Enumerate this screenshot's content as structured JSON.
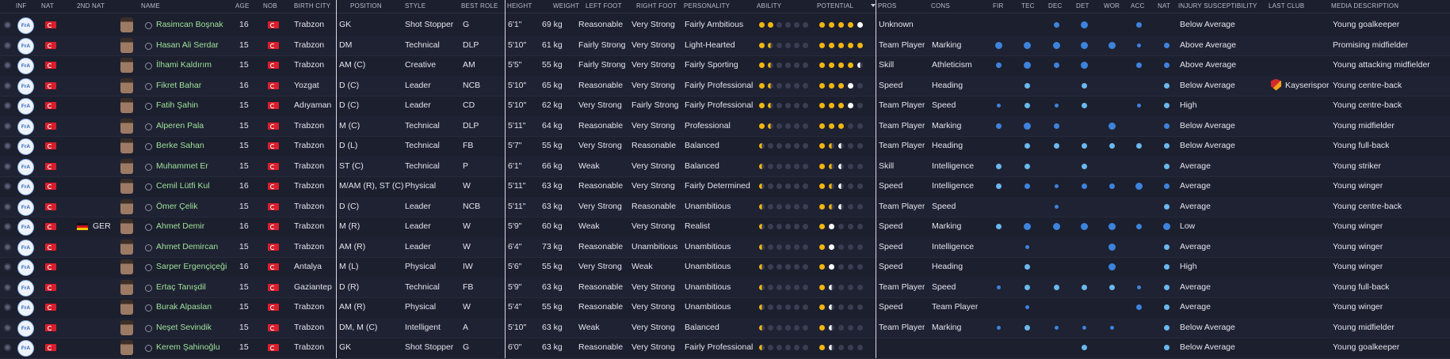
{
  "columns": [
    "INF",
    "NAT",
    "2ND NAT",
    "NAME",
    "AGE",
    "NOB",
    "BIRTH CITY",
    "POSITION",
    "STYLE",
    "BEST ROLE",
    "HEIGHT",
    "WEIGHT",
    "LEFT FOOT",
    "RIGHT FOOT",
    "PERSONALITY",
    "ABILITY",
    "POTENTIAL",
    "PROS",
    "CONS",
    "FIR",
    "TEC",
    "DEC",
    "DET",
    "WOR",
    "ACC",
    "NAT",
    "INJURY SUSCEPTIBILITY",
    "LAST CLUB",
    "MEDIA DESCRIPTION"
  ],
  "club_badge_text": "FrA",
  "colors": {
    "name_green": "#9fe39c",
    "star_gold": "#f2b60f",
    "attr_blue": "#3d83dd",
    "attr_light": "#6ab8ef"
  },
  "players": [
    {
      "name": "Rasimcan Boşnak",
      "second_nat": "",
      "age": "16",
      "city": "Trabzon",
      "position": "GK",
      "style": "Shot Stopper",
      "best_role": "G",
      "height": "6'1\"",
      "weight": "69 kg",
      "left_foot": "Reasonable",
      "right_foot": "Very Strong",
      "personality": "Fairly Ambitious",
      "ability": [
        1,
        1,
        0,
        0,
        0,
        0
      ],
      "potential": [
        1,
        1,
        1,
        1,
        2
      ],
      "pros": "Unknown",
      "cons": "",
      "attrs": [
        "",
        "",
        "m",
        "l",
        "",
        "m",
        ""
      ],
      "injury": "Below Average",
      "last_club": "",
      "media": "Young goalkeeper"
    },
    {
      "name": "Hasan Ali Serdar",
      "second_nat": "",
      "age": "15",
      "city": "Trabzon",
      "position": "DM",
      "style": "Technical",
      "best_role": "DLP",
      "height": "5'10\"",
      "weight": "61 kg",
      "left_foot": "Fairly Strong",
      "right_foot": "Very Strong",
      "personality": "Light-Hearted",
      "ability": [
        1,
        0.5,
        0,
        0,
        0,
        0
      ],
      "potential": [
        1,
        1,
        1,
        1,
        1
      ],
      "pros": "Team Player",
      "cons": "Marking",
      "attrs": [
        "l",
        "l",
        "l",
        "l",
        "l",
        "s",
        "m"
      ],
      "injury": "Above Average",
      "last_club": "",
      "media": "Promising midfielder"
    },
    {
      "name": "İlhami Kaldırım",
      "second_nat": "",
      "age": "15",
      "city": "Trabzon",
      "position": "AM (C)",
      "style": "Creative",
      "best_role": "AM",
      "height": "5'5\"",
      "weight": "55 kg",
      "left_foot": "Fairly Strong",
      "right_foot": "Very Strong",
      "personality": "Fairly Sporting",
      "ability": [
        1,
        0.5,
        0,
        0,
        0,
        0
      ],
      "potential": [
        1,
        1,
        1,
        1,
        2.5
      ],
      "pros": "Skill",
      "cons": "Athleticism",
      "attrs": [
        "m",
        "l",
        "m",
        "l",
        "",
        "m",
        "m"
      ],
      "injury": "Above Average",
      "last_club": "",
      "media": "Young attacking midfielder"
    },
    {
      "name": "Fikret Bahar",
      "second_nat": "",
      "age": "16",
      "city": "Yozgat",
      "position": "D (C)",
      "style": "Leader",
      "best_role": "NCB",
      "height": "5'10\"",
      "weight": "65 kg",
      "left_foot": "Reasonable",
      "right_foot": "Very Strong",
      "personality": "Fairly Professional",
      "ability": [
        1,
        0.5,
        0,
        0,
        0,
        0
      ],
      "potential": [
        1,
        1,
        1,
        2,
        0
      ],
      "pros": "Speed",
      "cons": "Heading",
      "attrs": [
        "",
        "lt",
        "",
        "lt",
        "",
        "",
        "lt"
      ],
      "injury": "Below Average",
      "last_club": "Kayserispor",
      "media": "Young centre-back"
    },
    {
      "name": "Fatih Şahin",
      "second_nat": "",
      "age": "15",
      "city": "Adıyaman",
      "position": "D (C)",
      "style": "Leader",
      "best_role": "CD",
      "height": "5'10\"",
      "weight": "62 kg",
      "left_foot": "Very Strong",
      "right_foot": "Fairly Strong",
      "personality": "Fairly Professional",
      "ability": [
        1,
        0.5,
        0,
        0,
        0,
        0
      ],
      "potential": [
        1,
        1,
        1,
        2,
        0
      ],
      "pros": "Team Player",
      "cons": "Speed",
      "attrs": [
        "s",
        "lt",
        "s",
        "lt",
        "",
        "s",
        "lt"
      ],
      "injury": "High",
      "last_club": "",
      "media": "Young centre-back"
    },
    {
      "name": "Alperen Pala",
      "second_nat": "",
      "age": "15",
      "city": "Trabzon",
      "position": "M (C)",
      "style": "Technical",
      "best_role": "DLP",
      "height": "5'11\"",
      "weight": "64 kg",
      "left_foot": "Reasonable",
      "right_foot": "Very Strong",
      "personality": "Professional",
      "ability": [
        1,
        0.5,
        0,
        0,
        0,
        0
      ],
      "potential": [
        1,
        1,
        1,
        0,
        0
      ],
      "pros": "Team Player",
      "cons": "Marking",
      "attrs": [
        "m",
        "l",
        "m",
        "",
        "l",
        "",
        "m"
      ],
      "injury": "Below Average",
      "last_club": "",
      "media": "Young midfielder"
    },
    {
      "name": "Berke Sahan",
      "second_nat": "",
      "age": "15",
      "city": "Trabzon",
      "position": "D (L)",
      "style": "Technical",
      "best_role": "FB",
      "height": "5'7\"",
      "weight": "55 kg",
      "left_foot": "Very Strong",
      "right_foot": "Reasonable",
      "personality": "Balanced",
      "ability": [
        0.5,
        0,
        0,
        0,
        0,
        0
      ],
      "potential": [
        1,
        0.5,
        2.5,
        0,
        0
      ],
      "pros": "Team Player",
      "cons": "Heading",
      "attrs": [
        "",
        "lt",
        "lt",
        "lt",
        "lt",
        "lt",
        "lt"
      ],
      "injury": "Below Average",
      "last_club": "",
      "media": "Young full-back"
    },
    {
      "name": "Muhammet Er",
      "second_nat": "",
      "age": "15",
      "city": "Trabzon",
      "position": "ST (C)",
      "style": "Technical",
      "best_role": "P",
      "height": "6'1\"",
      "weight": "66 kg",
      "left_foot": "Weak",
      "right_foot": "Very Strong",
      "personality": "Balanced",
      "ability": [
        0.5,
        0,
        0,
        0,
        0,
        0
      ],
      "potential": [
        1,
        0.5,
        2.5,
        0,
        0
      ],
      "pros": "Skill",
      "cons": "Intelligence",
      "attrs": [
        "lt",
        "lt",
        "",
        "lt",
        "",
        "",
        "lt"
      ],
      "injury": "Average",
      "last_club": "",
      "media": "Young striker"
    },
    {
      "name": "Cemil Lütfi Kul",
      "second_nat": "",
      "age": "16",
      "city": "Trabzon",
      "position": "M/AM (R), ST (C)",
      "style": "Physical",
      "best_role": "W",
      "height": "5'11\"",
      "weight": "63 kg",
      "left_foot": "Reasonable",
      "right_foot": "Very Strong",
      "personality": "Fairly Determined",
      "ability": [
        0.5,
        0,
        0,
        0,
        0,
        0
      ],
      "potential": [
        1,
        0.5,
        2.5,
        0,
        0
      ],
      "pros": "Speed",
      "cons": "Intelligence",
      "attrs": [
        "lt",
        "m",
        "s",
        "m",
        "m",
        "l",
        "m"
      ],
      "injury": "Average",
      "last_club": "",
      "media": "Young winger"
    },
    {
      "name": "Ömer Çelik",
      "second_nat": "",
      "age": "15",
      "city": "Trabzon",
      "position": "D (C)",
      "style": "Leader",
      "best_role": "NCB",
      "height": "5'11\"",
      "weight": "63 kg",
      "left_foot": "Very Strong",
      "right_foot": "Reasonable",
      "personality": "Unambitious",
      "ability": [
        0.5,
        0,
        0,
        0,
        0,
        0
      ],
      "potential": [
        1,
        0.5,
        2.5,
        0,
        0
      ],
      "pros": "Team Player",
      "cons": "Speed",
      "attrs": [
        "",
        "",
        "s",
        "",
        "",
        "",
        "lt"
      ],
      "injury": "Average",
      "last_club": "",
      "media": "Young centre-back"
    },
    {
      "name": "Ahmet Demir",
      "second_nat": "GER",
      "age": "16",
      "city": "Trabzon",
      "position": "M (R)",
      "style": "Leader",
      "best_role": "W",
      "height": "5'9\"",
      "weight": "60 kg",
      "left_foot": "Weak",
      "right_foot": "Very Strong",
      "personality": "Realist",
      "ability": [
        0.5,
        0,
        0,
        0,
        0,
        0
      ],
      "potential": [
        1,
        2,
        0,
        0,
        0
      ],
      "pros": "Speed",
      "cons": "Marking",
      "attrs": [
        "lt",
        "l",
        "l",
        "l",
        "l",
        "m",
        "l"
      ],
      "injury": "Low",
      "last_club": "",
      "media": "Young winger"
    },
    {
      "name": "Ahmet Demircan",
      "second_nat": "",
      "age": "15",
      "city": "Trabzon",
      "position": "AM (R)",
      "style": "Leader",
      "best_role": "W",
      "height": "6'4\"",
      "weight": "73 kg",
      "left_foot": "Reasonable",
      "right_foot": "Unambitious",
      "personality": "Unambitious",
      "ability": [
        0.5,
        0,
        0,
        0,
        0,
        0
      ],
      "potential": [
        1,
        2,
        0,
        0,
        0
      ],
      "pros": "Speed",
      "cons": "Intelligence",
      "attrs": [
        "",
        "s",
        "",
        "",
        "l",
        "",
        "lt"
      ],
      "injury": "Average",
      "last_club": "",
      "media": "Young winger"
    },
    {
      "name": "Sarper Ergençiçeği",
      "second_nat": "",
      "age": "16",
      "city": "Antalya",
      "position": "M (L)",
      "style": "Physical",
      "best_role": "IW",
      "height": "5'6\"",
      "weight": "55 kg",
      "left_foot": "Very Strong",
      "right_foot": "Weak",
      "personality": "Unambitious",
      "ability": [
        0.5,
        0,
        0,
        0,
        0,
        0
      ],
      "potential": [
        1,
        2,
        0,
        0,
        0
      ],
      "pros": "Speed",
      "cons": "Heading",
      "attrs": [
        "",
        "lt",
        "",
        "",
        "l",
        "",
        "lt"
      ],
      "injury": "High",
      "last_club": "",
      "media": "Young winger"
    },
    {
      "name": "Ertaç Tanışdil",
      "second_nat": "",
      "age": "15",
      "city": "Gaziantep",
      "position": "D (R)",
      "style": "Technical",
      "best_role": "FB",
      "height": "5'9\"",
      "weight": "63 kg",
      "left_foot": "Reasonable",
      "right_foot": "Very Strong",
      "personality": "Unambitious",
      "ability": [
        0.5,
        0,
        0,
        0,
        0,
        0
      ],
      "potential": [
        1,
        2.5,
        0,
        0,
        0
      ],
      "pros": "Team Player",
      "cons": "Speed",
      "attrs": [
        "s",
        "lt",
        "lt",
        "lt",
        "lt",
        "s",
        "lt"
      ],
      "injury": "Average",
      "last_club": "",
      "media": "Young full-back"
    },
    {
      "name": "Burak Alpaslan",
      "second_nat": "",
      "age": "15",
      "city": "Trabzon",
      "position": "AM (R)",
      "style": "Physical",
      "best_role": "W",
      "height": "5'4\"",
      "weight": "55 kg",
      "left_foot": "Reasonable",
      "right_foot": "Very Strong",
      "personality": "Unambitious",
      "ability": [
        0.5,
        0,
        0,
        0,
        0,
        0
      ],
      "potential": [
        1,
        2.5,
        0,
        0,
        0
      ],
      "pros": "Speed",
      "cons": "Team Player",
      "attrs": [
        "",
        "s",
        "",
        "",
        "",
        "m",
        "lt"
      ],
      "injury": "Average",
      "last_club": "",
      "media": "Young winger"
    },
    {
      "name": "Neşet Sevindik",
      "second_nat": "",
      "age": "15",
      "city": "Trabzon",
      "position": "DM, M (C)",
      "style": "Intelligent",
      "best_role": "A",
      "height": "5'10\"",
      "weight": "63 kg",
      "left_foot": "Weak",
      "right_foot": "Very Strong",
      "personality": "Balanced",
      "ability": [
        0.5,
        0,
        0,
        0,
        0,
        0
      ],
      "potential": [
        1,
        2.5,
        0,
        0,
        0
      ],
      "pros": "Team Player",
      "cons": "Marking",
      "attrs": [
        "s",
        "lt",
        "s",
        "s",
        "s",
        "",
        "lt"
      ],
      "injury": "Below Average",
      "last_club": "",
      "media": "Young midfielder"
    },
    {
      "name": "Kerem Şahinoğlu",
      "second_nat": "",
      "age": "15",
      "city": "Trabzon",
      "position": "GK",
      "style": "Shot Stopper",
      "best_role": "G",
      "height": "6'0\"",
      "weight": "63 kg",
      "left_foot": "Reasonable",
      "right_foot": "Very Strong",
      "personality": "Fairly Professional",
      "ability": [
        0.5,
        0,
        0,
        0,
        0,
        0
      ],
      "potential": [
        1,
        2.5,
        0,
        0,
        0
      ],
      "pros": "",
      "cons": "",
      "attrs": [
        "",
        "",
        "",
        "lt",
        "",
        "",
        "lt"
      ],
      "injury": "Below Average",
      "last_club": "",
      "media": "Young goalkeeper"
    }
  ]
}
